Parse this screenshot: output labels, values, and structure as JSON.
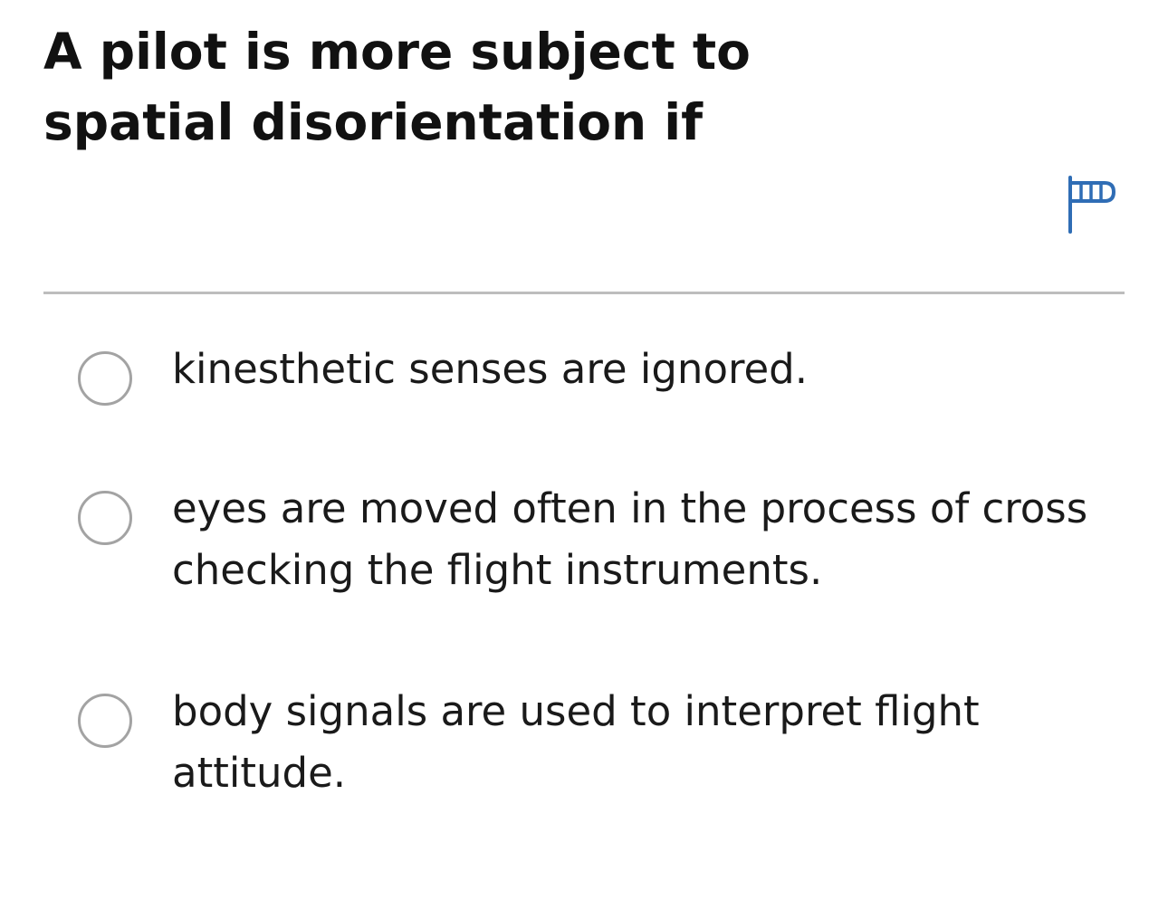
{
  "question": {
    "text": "A pilot is more subject to spatial disorientation if"
  },
  "flag": {
    "icon": "flag-icon",
    "color": "#2f6db5"
  },
  "options": [
    {
      "text": "kinesthetic senses are ignored.",
      "selected": false
    },
    {
      "text": "eyes are moved often in the process of cross checking the flight instruments.",
      "selected": false
    },
    {
      "text": "body signals are used to interpret flight attitude.",
      "selected": false
    }
  ],
  "colors": {
    "divider": "#bdbdbd",
    "radio_border": "#a3a3a3",
    "text": "#1a1a1a"
  }
}
